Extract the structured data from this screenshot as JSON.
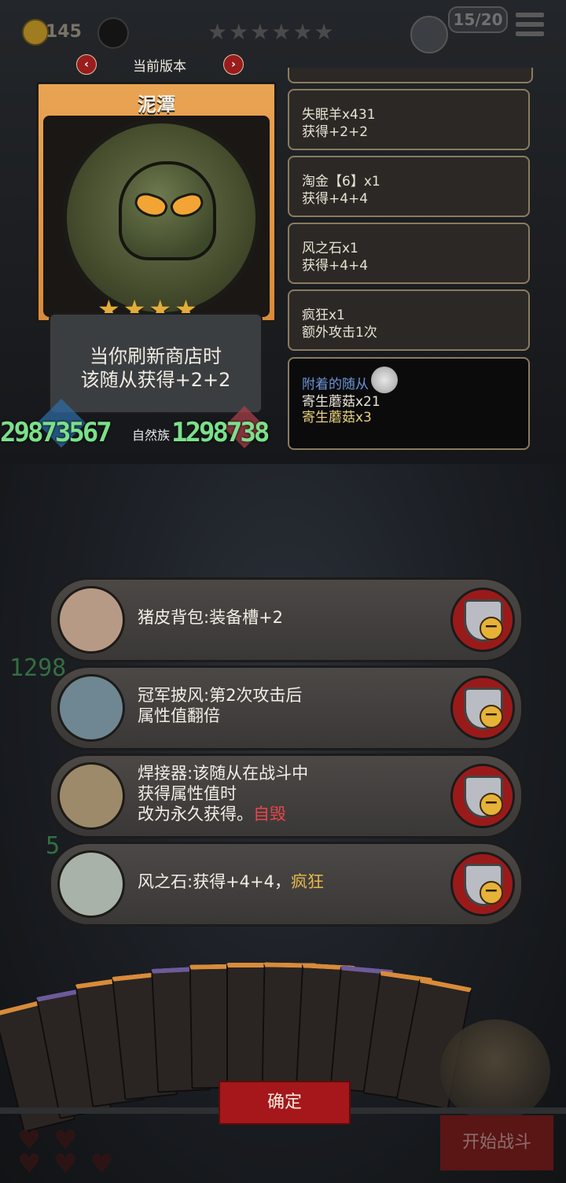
{
  "topbar": {
    "coin_count": "145",
    "stars": "★★★★★★",
    "turn_counter": "15/20"
  },
  "version": {
    "label": "当前版本",
    "prev": "‹",
    "next": "›"
  },
  "card": {
    "name": "泥潭",
    "stars": "★★★★",
    "desc_line1": "当你刷新商店时",
    "desc_line2": "该随从获得+2+2",
    "num_left": "29873567",
    "num_mid": "自然族",
    "num_right": "1298738"
  },
  "effects": [
    {
      "line1": "失眠羊x431",
      "line2": "获得+2+2"
    },
    {
      "line1": "淘金【6】x1",
      "line2": "获得+4+4"
    },
    {
      "line1": "风之石x1",
      "line2": "获得+4+4"
    },
    {
      "line1": "疯狂x1",
      "line2": "额外攻击1次"
    }
  ],
  "attached": {
    "header": "附着的随从",
    "item1": "寄生蘑菇x21",
    "item2": "寄生蘑菇x3"
  },
  "equipment": [
    {
      "text": "猪皮背包:装备槽+2",
      "icon": "pig-backpack-icon"
    },
    {
      "line1": "冠军披风:第2次攻击后",
      "line2": "属性值翻倍",
      "icon": "champion-cape-icon"
    },
    {
      "line1": "焊接器:该随从在战斗中",
      "line2": "获得属性值时",
      "line3": "改为永久获得。",
      "tag": "自毁",
      "icon": "welder-icon"
    },
    {
      "text": "风之石:获得+4+4，",
      "tag": "疯狂",
      "icon": "wind-stone-icon"
    }
  ],
  "buttons": {
    "confirm": "确定",
    "start_battle": "开始战斗"
  },
  "background_numbers": {
    "n1": "1298",
    "n2": "5"
  },
  "colors": {
    "accent_red": "#a5171b",
    "card_orange": "#e9a453",
    "green_numbers": "#7be08a"
  }
}
